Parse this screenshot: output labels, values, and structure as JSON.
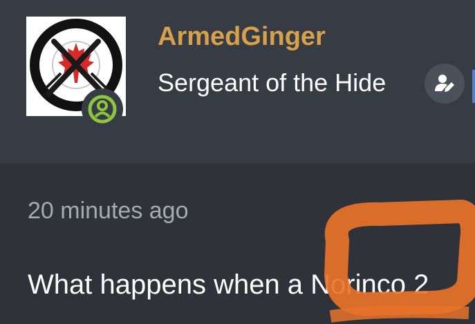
{
  "profile": {
    "username": "ArmedGinger",
    "title": "Sergeant of the Hide",
    "avatar_icon": "maple-leaf-no-guns-icon",
    "online_status_icon": "online-user-icon",
    "edit_icon": "edit-user-icon"
  },
  "post": {
    "timestamp": "20 minutes ago",
    "text": "What happens when a Norinco 2"
  },
  "colors": {
    "username": "#d7a04c",
    "header_bg": "#373c44",
    "page_bg": "#2f3339",
    "online": "#8cc63f",
    "redaction": "#e8732a"
  }
}
